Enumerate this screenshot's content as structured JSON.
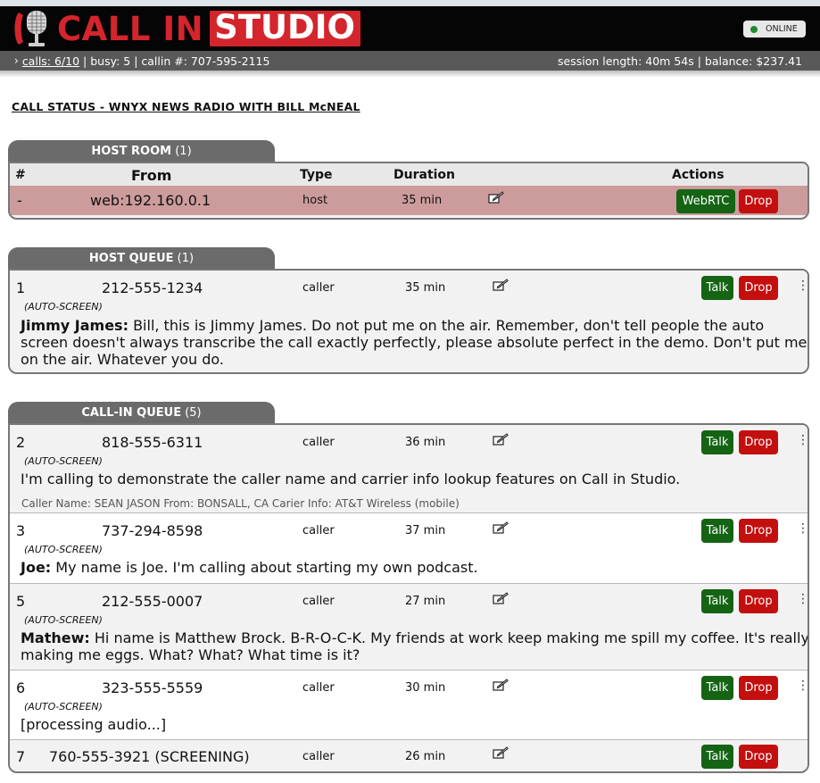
{
  "app": {
    "logo_call": "CALL IN",
    "logo_studio": "STUDIO",
    "online_label": "ONLINE",
    "accent_color": "#d4252c",
    "online_color": "#1f8b2c"
  },
  "statusbar": {
    "calls": "calls: 6/10",
    "rest": " | busy: 5 | callin #: 707-595-2115",
    "session": "session length: 40m 54s | balance: $237.41"
  },
  "page_title": "CALL STATUS - WNYX NEWS RADIO WITH BILL McNEAL",
  "host_room": {
    "tab_label": "HOST ROOM",
    "tab_count": "(1)",
    "columns": {
      "num": "#",
      "from": "From",
      "type": "Type",
      "duration": "Duration",
      "actions": "Actions"
    },
    "row": {
      "num": "-",
      "from": "web:192.160.0.1",
      "type": "host",
      "duration": "35 min",
      "webrtc_label": "WebRTC",
      "drop_label": "Drop"
    }
  },
  "host_queue": {
    "tab_label": "HOST QUEUE",
    "tab_count": "(1)",
    "rows": [
      {
        "num": "1",
        "from": "212-555-1234",
        "type": "caller",
        "duration": "35 min",
        "auto": "(AUTO-SCREEN)",
        "speaker": "Jimmy James:",
        "text": " Bill, this is Jimmy James. Do not put me on the air. Remember, don't tell people the auto screen doesn't always transcribe the call exactly perfectly, please absolute perfect in the demo. Don't put me on the air. Whatever you do.",
        "talk_label": "Talk",
        "drop_label": "Drop"
      }
    ]
  },
  "callin_queue": {
    "tab_label": "CALL-IN QUEUE",
    "tab_count": "(5)",
    "rows": [
      {
        "num": "2",
        "from": "818-555-6311",
        "type": "caller",
        "duration": "36 min",
        "auto": "(AUTO-SCREEN)",
        "speaker": "",
        "text": "I'm calling to demonstrate the caller name and carrier info lookup features on Call in Studio.",
        "caller_info": "Caller Name: SEAN JASON From: BONSALL, CA Carier Info: AT&T Wireless (mobile)",
        "talk_label": "Talk",
        "drop_label": "Drop"
      },
      {
        "num": "3",
        "from": "737-294-8598",
        "type": "caller",
        "duration": "37 min",
        "auto": "(AUTO-SCREEN)",
        "speaker": "Joe:",
        "text": " My name is Joe. I'm calling about starting my own podcast.",
        "talk_label": "Talk",
        "drop_label": "Drop"
      },
      {
        "num": "5",
        "from": "212-555-0007",
        "type": "caller",
        "duration": "27 min",
        "auto": "(AUTO-SCREEN)",
        "speaker": "Mathew:",
        "text": " Hi name is Matthew Brock. B-R-O-C-K. My friends at work keep making me spill my coffee. It's really making me eggs. What? What? What time is it?",
        "talk_label": "Talk",
        "drop_label": "Drop"
      },
      {
        "num": "6",
        "from": "323-555-5559",
        "type": "caller",
        "duration": "30 min",
        "auto": "(AUTO-SCREEN)",
        "speaker": "",
        "text": "[processing audio...]",
        "talk_label": "Talk",
        "drop_label": "Drop"
      },
      {
        "num": "7",
        "from": "760-555-3921 (SCREENING)",
        "type": "caller",
        "duration": "26 min",
        "talk_label": "Talk",
        "drop_label": "Drop"
      }
    ]
  }
}
